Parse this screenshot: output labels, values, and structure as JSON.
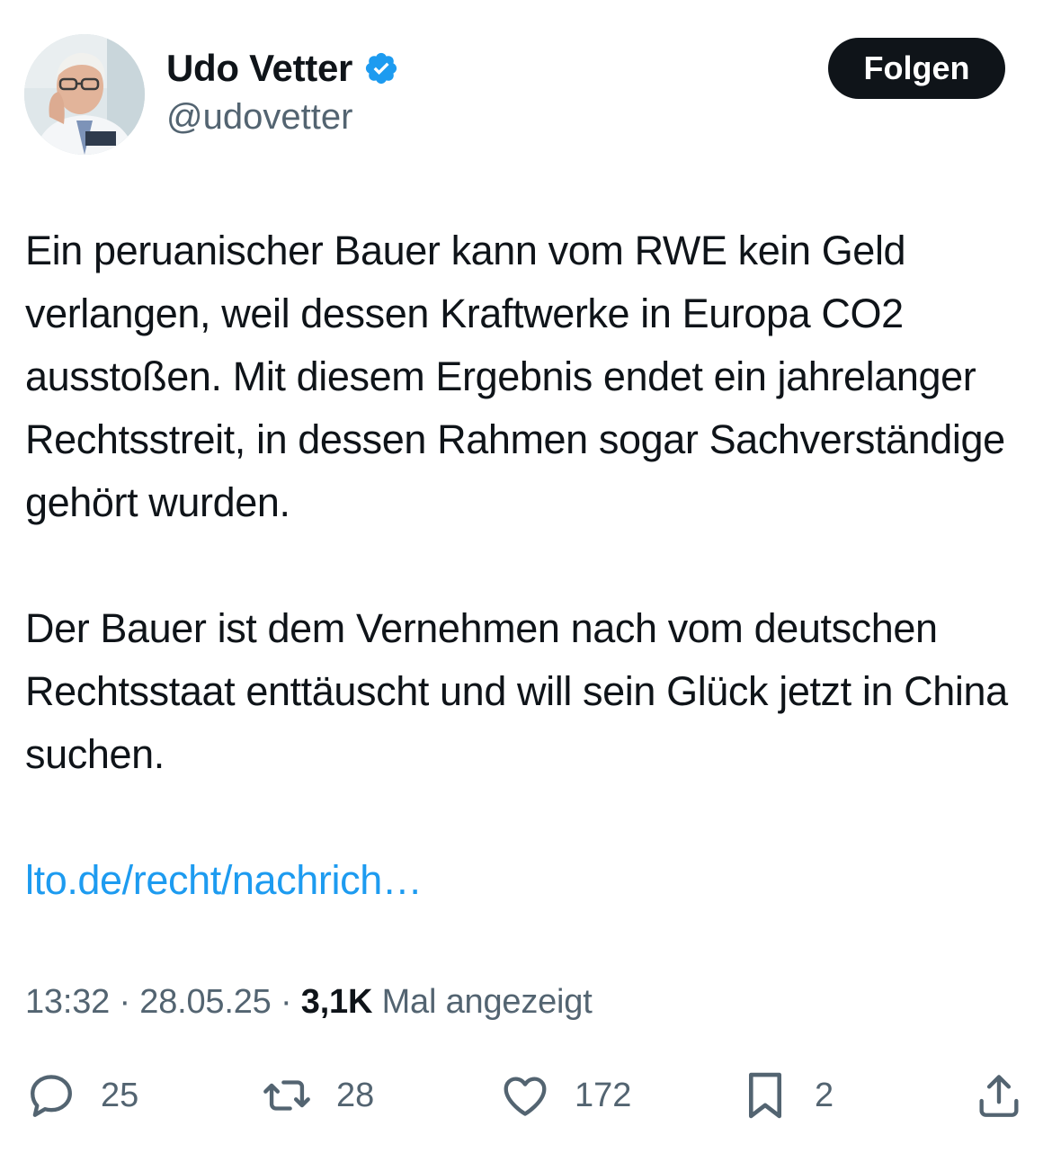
{
  "author": {
    "display_name": "Udo Vetter",
    "handle": "@udovetter",
    "verified": true
  },
  "follow_button": {
    "label": "Folgen"
  },
  "tweet": {
    "paragraph_1": "Ein peruanischer Bauer kann vom RWE kein Geld verlangen, weil dessen Kraftwerke in Europa CO2 ausstoßen. Mit diesem Ergebnis endet ein jahrelanger Rechtsstreit, in dessen Rahmen sogar Sachverständige gehört wurden.",
    "paragraph_2": "Der Bauer ist dem Vernehmen nach vom deutschen Rechtsstaat enttäuscht und will sein Glück jetzt in China suchen.",
    "link_text": "lto.de/recht/nachrich…"
  },
  "meta": {
    "time": "13:32",
    "separator": " · ",
    "date": "28.05.25",
    "views": "3,1K",
    "views_label": "Mal angezeigt"
  },
  "actions": {
    "replies": "25",
    "reposts": "28",
    "likes": "172",
    "bookmarks": "2"
  },
  "colors": {
    "text": "#0f1419",
    "secondary": "#536471",
    "link": "#1d9bf0",
    "verified": "#1d9bf0",
    "button_bg": "#0f1419"
  },
  "icons": [
    "verified-badge-icon",
    "reply-icon",
    "repost-icon",
    "like-icon",
    "bookmark-icon",
    "share-icon"
  ]
}
